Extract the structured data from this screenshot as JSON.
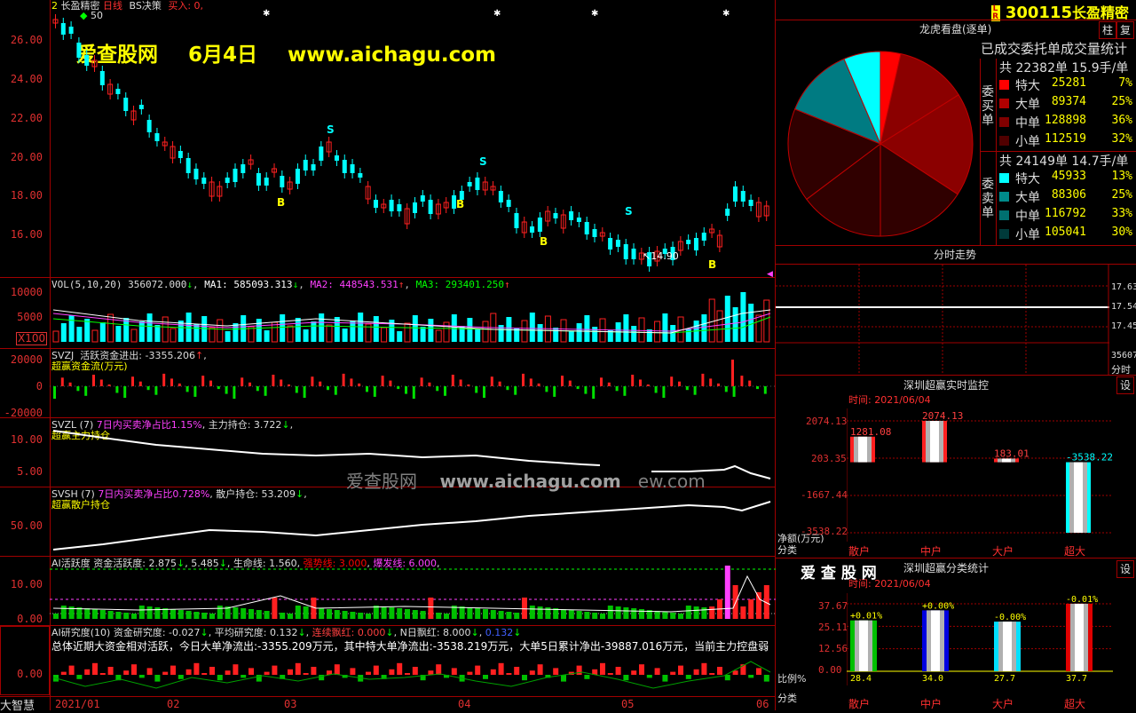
{
  "window": {
    "stock_code": "300115",
    "stock_name": "长盈精密",
    "top_label_name": "长盈精密",
    "top_label_period": "日线",
    "top_label_strategy": "BS决策",
    "top_label_buy": "买入: 0,",
    "top_label_ma": "2",
    "top_label_val": "50"
  },
  "watermark": {
    "site_name": "爱查股网",
    "date": "6月4日",
    "url": "www.aichagu.com",
    "mid_text": "爱查股网",
    "mid_url": "www.aichagu.com",
    "mid_tail": "ew.com",
    "bottom_brand": "爱 查 股 网"
  },
  "price_axis": [
    "26.00",
    "24.00",
    "22.00",
    "20.00",
    "18.00",
    "16.00"
  ],
  "price_low_label": "14.90",
  "signals": {
    "b": "B",
    "s": "S"
  },
  "vol_panel": {
    "label": "VOL(5,10,20)",
    "vol": "356072.000",
    "ma1": "MA1: 585093.313",
    "ma2": "MA2: 448543.531",
    "ma3": "MA3: 293401.250",
    "axis": [
      "10000",
      "5000"
    ],
    "unit": "X100"
  },
  "svzj_panel": {
    "label": "SVZJ",
    "text": "活跃资金进出: -3355.206",
    "sub": "超赢资金流(万元)",
    "axis": [
      "20000",
      "0",
      "-20000"
    ]
  },
  "svzl_panel": {
    "label": "SVZL (7)",
    "ratio": "7日内买卖净占比1.15%",
    "hold": "主力持仓: 3.722",
    "sub": "超赢主力持仓",
    "axis": [
      "10.00",
      "5.00"
    ]
  },
  "svsh_panel": {
    "label": "SVSH (7)",
    "ratio": "7日内买卖净占比0.728%",
    "hold": "散户持仓: 53.209",
    "sub": "超赢散户持仓",
    "axis": [
      "50.00"
    ]
  },
  "ai_active_panel": {
    "label": "AI活跃度",
    "text1": "资金活跃度: 2.875",
    "text2": "5.485",
    "life": "生命线: 1.560",
    "strong": "强势线: 3.000",
    "burst": "爆发线: 6.000",
    "axis": [
      "10.00",
      "0.00"
    ]
  },
  "ai_research_panel": {
    "label": "AI研究度(10)",
    "text1": "资金研究度: -0.027",
    "avg": "平均研究度: 0.132",
    "lian": "连续飘红: 0.000",
    "n_day": "N日飘红: 8.000",
    "last": "0.132",
    "summary": "总体近期大资金相对活跃，今日大单净流出:-3355.209万元，其中特大单净流出:-3538.219万元，大单5日累计净出-39887.016万元，当前主力控盘弱",
    "axis": [
      "0.00"
    ]
  },
  "bottom_left_label": "大智慧",
  "date_axis": [
    "2021/01",
    "02",
    "03",
    "04",
    "05",
    "06"
  ],
  "right_panel": {
    "dragon_title": "龙虎看盘(逐单)",
    "stats_title": "已成交委托单成交量统计",
    "buy_side_label": "委买单",
    "sell_side_label": "委卖单",
    "buy_total": "共 22382单 15.9手/单",
    "sell_total": "共 24149单 14.7手/单",
    "buy_rows": [
      {
        "name": "特大",
        "value": "25281",
        "pct": "7%",
        "color": "#ff0000"
      },
      {
        "name": "大单",
        "value": "89374",
        "pct": "25%",
        "color": "#b00000"
      },
      {
        "name": "中单",
        "value": "128898",
        "pct": "36%",
        "color": "#800000"
      },
      {
        "name": "小单",
        "value": "112519",
        "pct": "32%",
        "color": "#500000"
      }
    ],
    "sell_rows": [
      {
        "name": "特大",
        "value": "45933",
        "pct": "13%",
        "color": "#00ffff"
      },
      {
        "name": "大单",
        "value": "88306",
        "pct": "25%",
        "color": "#008b8b"
      },
      {
        "name": "中单",
        "value": "116792",
        "pct": "33%",
        "color": "#007070"
      },
      {
        "name": "小单",
        "value": "105041",
        "pct": "30%",
        "color": "#003a3a"
      }
    ],
    "btn_zhu": "柱",
    "btn_fu": "复",
    "timeshare_title": "分时走势",
    "timeshare_axis": [
      "17.63",
      "17.54",
      "17.45"
    ],
    "timeshare_vol": "35607",
    "timeshare_vol2": "分时",
    "monitor_title": "深圳超赢实时监控",
    "monitor_btn": "设",
    "monitor_time": "时间: 2021/06/04",
    "monitor_axis": [
      "2074.13",
      "203.35",
      "-1667.44",
      "-3538.22"
    ],
    "monitor_ylabel": "净额(万元)",
    "monitor_xlabel": "分类",
    "monitor_bars": [
      {
        "name": "散户",
        "value": "1281.08"
      },
      {
        "name": "中户",
        "value": "2074.13"
      },
      {
        "name": "大户",
        "value": "183.01"
      },
      {
        "name": "超大",
        "value": "-3538.22"
      }
    ],
    "class_title": "深圳超赢分类统计",
    "class_btn": "设",
    "class_time": "时间: 2021/06/04",
    "class_axis": [
      "37.67",
      "25.11",
      "12.56",
      "0.00"
    ],
    "class_ylabel": "比例%",
    "class_xlabel": "分类",
    "class_bars": [
      {
        "name": "散户",
        "value": 28.4,
        "value_label": "28.4",
        "change": "+0.01%",
        "color": "#00c000"
      },
      {
        "name": "中户",
        "value": 34.0,
        "value_label": "34.0",
        "change": "+0.00%",
        "color": "#0000e0"
      },
      {
        "name": "大户",
        "value": 27.7,
        "value_label": "27.7",
        "change": "-0.00%",
        "color": "#00e0ff"
      },
      {
        "name": "超大",
        "value": 37.7,
        "value_label": "37.7",
        "change": "-0.01%",
        "color": "#e00000"
      }
    ]
  },
  "chart_data": {
    "type": "pie",
    "title": "已成交委托单成交量统计",
    "categories": [
      "买特大",
      "买大单",
      "买中单",
      "买小单",
      "卖小单",
      "卖中单",
      "卖大单",
      "卖特大"
    ],
    "values": [
      25281,
      89374,
      128898,
      112519,
      105041,
      116792,
      88306,
      45933
    ],
    "colors": [
      "#ff0000",
      "#8b0000",
      "#8b0000",
      "#300000",
      "#300000",
      "#300000",
      "#007b82",
      "#00ffff"
    ]
  }
}
